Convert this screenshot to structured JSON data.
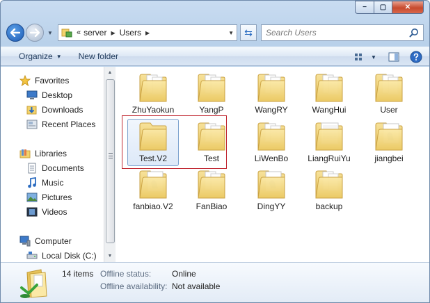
{
  "window": {
    "caption": {
      "minimize": "−",
      "maximize": "▢",
      "close": "✕"
    }
  },
  "address_bar": {
    "overflow": "«",
    "crumbs": [
      "server",
      "Users"
    ],
    "refresh_glyph": "⇆"
  },
  "search": {
    "placeholder": "Search Users"
  },
  "toolbar": {
    "organize": "Organize",
    "new_folder": "New folder"
  },
  "nav_pane": {
    "items": [
      {
        "label": "Favorites",
        "icon": "star-icon"
      },
      {
        "label": "Desktop",
        "icon": "desktop-icon"
      },
      {
        "label": "Downloads",
        "icon": "downloads-icon"
      },
      {
        "label": "Recent Places",
        "icon": "recent-places-icon"
      },
      {
        "label": "Libraries",
        "icon": "libraries-icon"
      },
      {
        "label": "Documents",
        "icon": "documents-icon"
      },
      {
        "label": "Music",
        "icon": "music-icon"
      },
      {
        "label": "Pictures",
        "icon": "pictures-icon"
      },
      {
        "label": "Videos",
        "icon": "videos-icon"
      },
      {
        "label": "Computer",
        "icon": "computer-icon"
      },
      {
        "label": "Local Disk (C:)",
        "icon": "drive-icon"
      }
    ]
  },
  "folders": [
    {
      "name": "ZhuYaokun"
    },
    {
      "name": "YangP"
    },
    {
      "name": "WangRY"
    },
    {
      "name": "WangHui"
    },
    {
      "name": "User"
    },
    {
      "name": "Test.V2"
    },
    {
      "name": "Test"
    },
    {
      "name": "LiWenBo"
    },
    {
      "name": "LiangRuiYu"
    },
    {
      "name": "jiangbei"
    },
    {
      "name": "fanbiao.V2"
    },
    {
      "name": "FanBiao"
    },
    {
      "name": "DingYY"
    },
    {
      "name": "backup"
    }
  ],
  "details": {
    "count": "14 items",
    "offline_status_label": "Offline status:",
    "offline_status_value": "Online",
    "offline_availability_label": "Offline availability:",
    "offline_availability_value": "Not available"
  },
  "colors": {
    "selection_border": "#7da2ce",
    "highlight_box": "#c0252f",
    "folder_yellow": "#f3d77a"
  }
}
